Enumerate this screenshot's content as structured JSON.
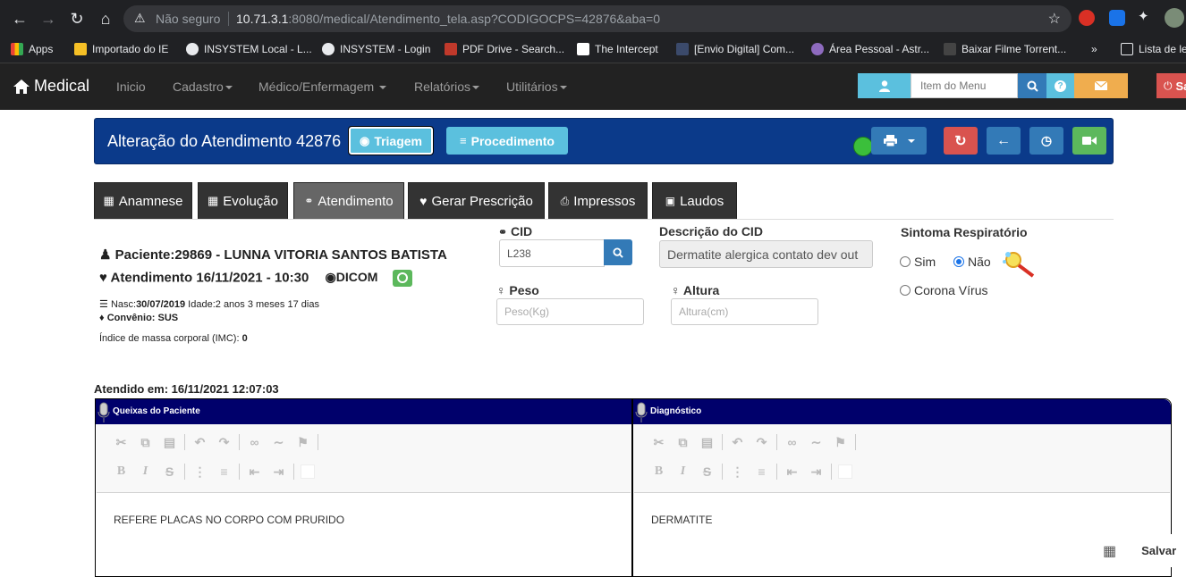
{
  "browser": {
    "insecure_label": "Não seguro",
    "url_host": "10.71.3.1",
    "url_rest": ":8080/medical/Atendimento_tela.asp?CODIGOCPS=42876&aba=0",
    "bookmarks": [
      "Apps",
      "Importado do IE",
      "INSYSTEM Local - L...",
      "INSYSTEM - Login",
      "PDF Drive - Search...",
      "The Intercept",
      "[Envio Digital] Com...",
      "Área Pessoal - Astr...",
      "Baixar Filme Torrent...",
      "»",
      "Lista de le"
    ]
  },
  "appbar": {
    "brand": "Medical",
    "menu": [
      "Inicio",
      "Cadastro",
      "Médico/Enfermagem",
      "Relatórios",
      "Utilitários"
    ],
    "search_placeholder": "Item do Menu",
    "logout_label": "Sa"
  },
  "panel": {
    "title": "Alteração do Atendimento 42876",
    "triagem_label": "Triagem",
    "procedimento_label": "Procedimento"
  },
  "tabs": [
    "Anamnese",
    "Evolução",
    "Atendimento",
    "Gerar Prescrição",
    "Impressos",
    "Laudos"
  ],
  "patient": {
    "name_line": "Paciente:29869 - LUNNA VITORIA SANTOS BATISTA",
    "atendimento_line": "Atendimento 16/11/2021 - 10:30",
    "dicom_label": "DICOM",
    "nasc_label": "Nasc:",
    "nasc_value": "30/07/2019",
    "idade": " Idade:2 anos 3 meses 17 dias",
    "convenio_label": "Convênio:",
    "convenio_value": "SUS",
    "imc_label": "Índice de massa corporal (IMC):",
    "imc_value": "0"
  },
  "form": {
    "cid_label": "CID",
    "cid_value": "L238",
    "desc_label": "Descrição do CID",
    "desc_value": "Dermatite alergica contato dev out",
    "peso_label": "Peso",
    "peso_placeholder": "Peso(Kg)",
    "altura_label": "Altura",
    "altura_placeholder": "Altura(cm)",
    "sintoma_label": "Sintoma Respiratório",
    "sim_label": "Sim",
    "nao_label": "Não",
    "corona_label": "Corona Vírus"
  },
  "atendido_em": "Atendido em: 16/11/2021 12:07:03",
  "editors": {
    "queixas_title": "Queixas do Paciente",
    "queixas_text": "REFERE PLACAS NO CORPO COM PRURIDO",
    "diag_title": "Diagnóstico",
    "diag_text": "DERMATITE"
  },
  "footer": {
    "save_label": "Salvar"
  },
  "colors": {
    "panel_bg": "#0b3a8a",
    "triagem": "#5bc0de",
    "danger": "#d9534f",
    "primary": "#337ab7",
    "success": "#5cb85c",
    "warning": "#f0ad4e",
    "editor_head": "#00006b"
  }
}
